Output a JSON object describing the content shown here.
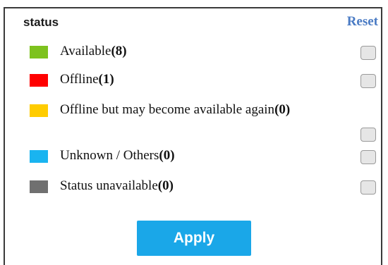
{
  "filter": {
    "title": "status",
    "reset_label": "Reset",
    "apply_label": "Apply",
    "items": [
      {
        "label": "Available",
        "count": "(8)",
        "color": "#7dc21e"
      },
      {
        "label": "Offline",
        "count": "(1)",
        "color": "#ff0000"
      },
      {
        "label": "Offline but may become available again",
        "count": "(0)",
        "color": "#ffcc00"
      },
      {
        "label": "Unknown / Others",
        "count": "(0)",
        "color": "#19b4f0"
      },
      {
        "label": "Status unavailable",
        "count": "(0)",
        "color": "#707070"
      }
    ]
  }
}
